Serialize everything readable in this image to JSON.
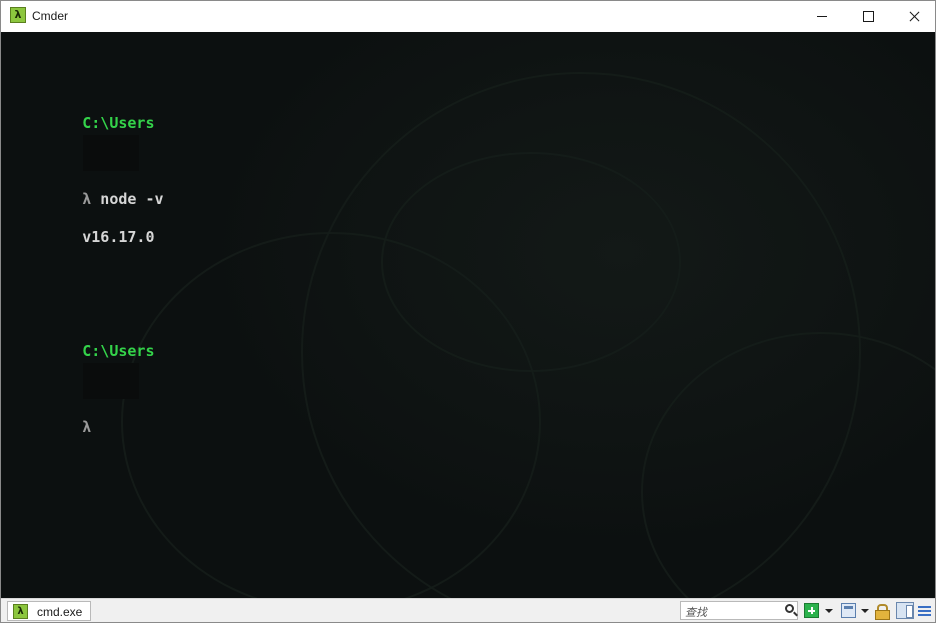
{
  "window": {
    "title": "Cmder",
    "app_icon_glyph": "λ"
  },
  "console": {
    "lines": [
      {
        "type": "path",
        "text": "C:\\Users"
      },
      {
        "type": "prompt",
        "symbol": "λ",
        "command": " node -v"
      },
      {
        "type": "output",
        "text": "v16.17.0"
      },
      {
        "type": "blank",
        "text": ""
      },
      {
        "type": "path",
        "text": "C:\\Users"
      },
      {
        "type": "prompt",
        "symbol": "λ",
        "command": ""
      }
    ],
    "colors": {
      "background": "#0c1010",
      "path": "#34d34a",
      "prompt": "#9a9a9a",
      "text": "#d6d6d6"
    }
  },
  "statusbar": {
    "tab_label": "cmd.exe",
    "tab_icon_glyph": "λ",
    "search_placeholder": "查找",
    "icons": [
      "search-icon",
      "new-console-plus-icon",
      "window-icon",
      "lock-icon",
      "panel-icon",
      "menu-icon"
    ]
  }
}
